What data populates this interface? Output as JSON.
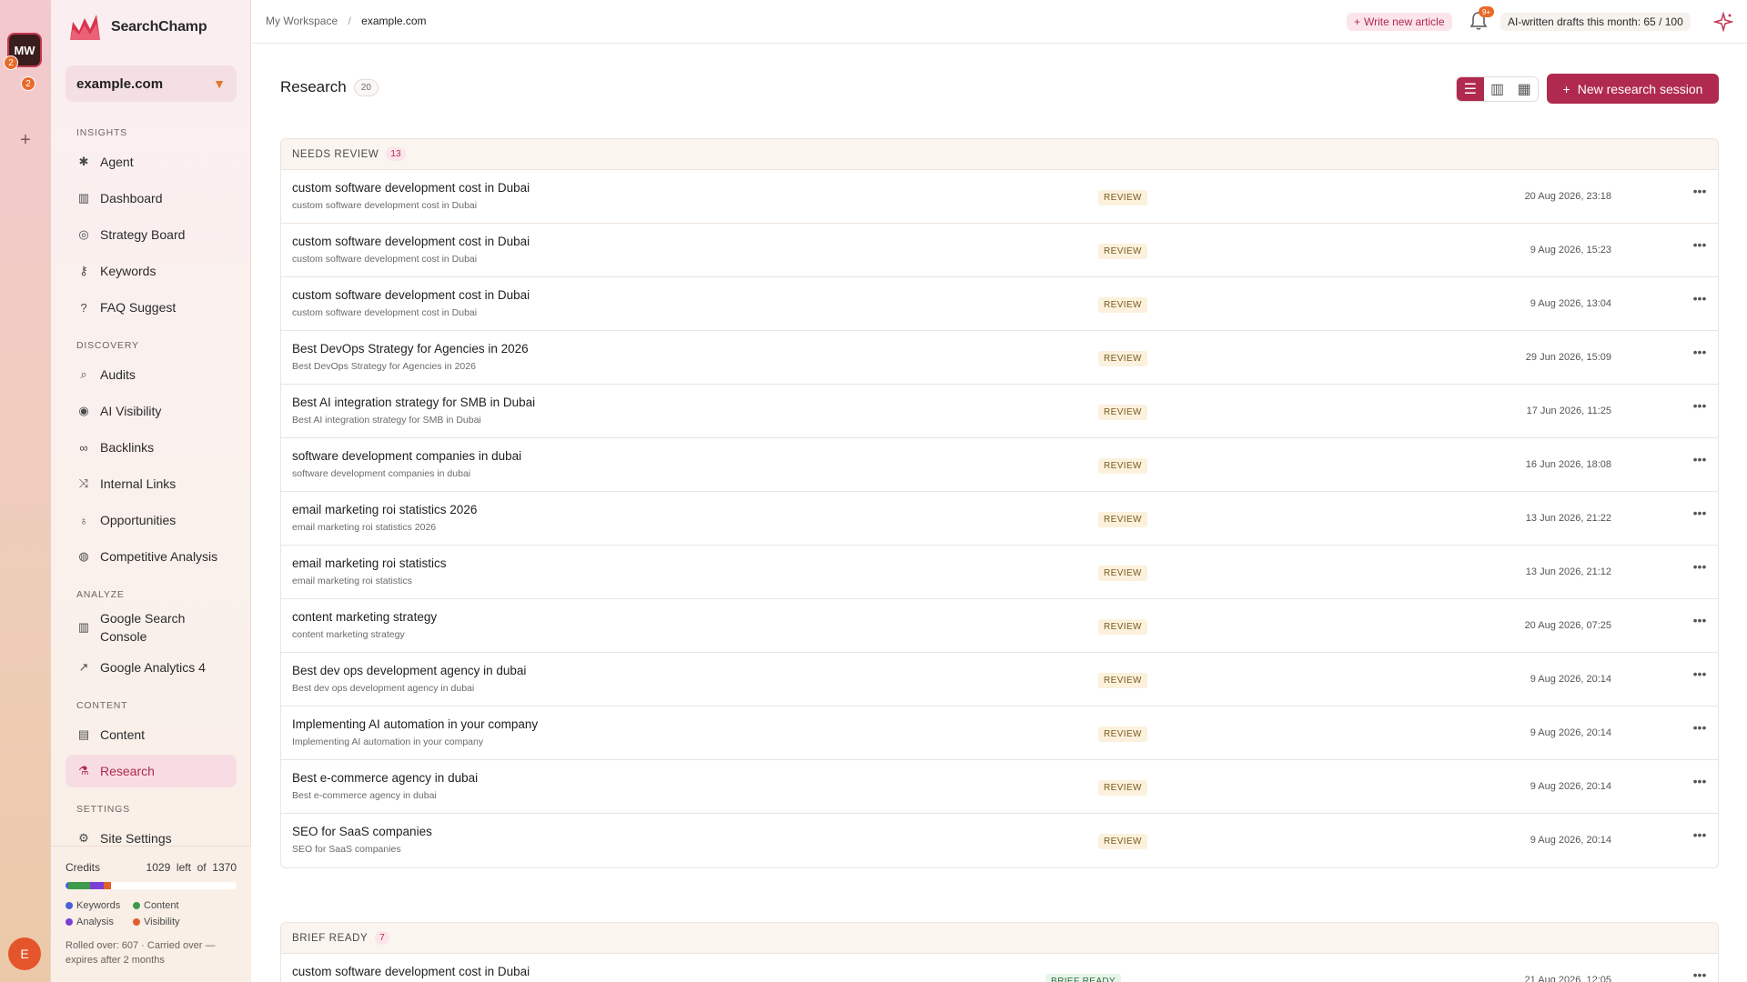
{
  "app": {
    "name": "SearchChamp"
  },
  "rail": {
    "workspace_initials": "MW",
    "badge_a": "2",
    "badge_b": "2",
    "add_label": "+",
    "user_initial": "E"
  },
  "site_selector": {
    "value": "example.com"
  },
  "sidebar": {
    "sections": [
      {
        "title": "INSIGHTS",
        "items": [
          {
            "label": "Agent",
            "icon": "sparkle-icon"
          },
          {
            "label": "Dashboard",
            "icon": "bar-chart-icon"
          },
          {
            "label": "Strategy Board",
            "icon": "target-icon"
          },
          {
            "label": "Keywords",
            "icon": "key-icon"
          },
          {
            "label": "FAQ Suggest",
            "icon": "question-icon"
          }
        ]
      },
      {
        "title": "DISCOVERY",
        "items": [
          {
            "label": "Audits",
            "icon": "search-icon"
          },
          {
            "label": "AI Visibility",
            "icon": "eye-icon"
          },
          {
            "label": "Backlinks",
            "icon": "link-icon"
          },
          {
            "label": "Internal Links",
            "icon": "share-icon"
          },
          {
            "label": "Opportunities",
            "icon": "lightbulb-icon"
          },
          {
            "label": "Competitive Analysis",
            "icon": "radar-icon"
          }
        ]
      },
      {
        "title": "ANALYZE",
        "items": [
          {
            "label": "Google Search Console",
            "icon": "bar-chart-icon"
          },
          {
            "label": "Google Analytics 4",
            "icon": "trend-icon"
          }
        ]
      },
      {
        "title": "CONTENT",
        "items": [
          {
            "label": "Content",
            "icon": "document-icon"
          },
          {
            "label": "Research",
            "icon": "flask-icon",
            "active": true
          }
        ]
      },
      {
        "title": "SETTINGS",
        "items": [
          {
            "label": "Site Settings",
            "icon": "gear-icon"
          }
        ]
      }
    ]
  },
  "credits": {
    "label": "Credits",
    "left": "1029",
    "left_word": "left",
    "of_word": "of",
    "total": "1370",
    "segments": [
      {
        "name": "Keywords",
        "color": "#4a5fd8",
        "fraction": 0.015
      },
      {
        "name": "Content",
        "color": "#3e9a4c",
        "fraction": 0.13
      },
      {
        "name": "Analysis",
        "color": "#7c3fd6",
        "fraction": 0.08
      },
      {
        "name": "Visibility",
        "color": "#e0602c",
        "fraction": 0.04
      }
    ],
    "note": "Rolled over: 607 · Carried over — expires after 2 months"
  },
  "topbar": {
    "breadcrumb": [
      "My Workspace",
      "example.com"
    ],
    "breadcrumb_sep": "/",
    "write_label": "Write new article",
    "notif_badge": "9+",
    "drafts_text": "AI-written drafts this month: 65 / 100"
  },
  "page": {
    "title": "Research",
    "count": "20",
    "new_button": "New research session"
  },
  "groups": [
    {
      "title": "NEEDS REVIEW",
      "count": "13",
      "status": "REVIEW",
      "rows": [
        {
          "title": "custom software development cost in Dubai",
          "sub": "custom software development cost in Dubai",
          "date": "20 Aug 2026, 23:18"
        },
        {
          "title": "custom software development cost in Dubai",
          "sub": "custom software development cost in Dubai",
          "date": "9 Aug 2026, 15:23"
        },
        {
          "title": "custom software development cost in Dubai",
          "sub": "custom software development cost in Dubai",
          "date": "9 Aug 2026, 13:04"
        },
        {
          "title": "Best DevOps Strategy for Agencies in 2026",
          "sub": "Best DevOps Strategy for Agencies in 2026",
          "date": "29 Jun 2026, 15:09"
        },
        {
          "title": "Best AI integration strategy for SMB in Dubai",
          "sub": "Best AI integration strategy for SMB in Dubai",
          "date": "17 Jun 2026, 11:25"
        },
        {
          "title": "software development companies in dubai",
          "sub": "software development companies in dubai",
          "date": "16 Jun 2026, 18:08"
        },
        {
          "title": "email marketing roi statistics 2026",
          "sub": "email marketing roi statistics 2026",
          "date": "13 Jun 2026, 21:22"
        },
        {
          "title": "email marketing roi statistics",
          "sub": "email marketing roi statistics",
          "date": "13 Jun 2026, 21:12"
        },
        {
          "title": "content marketing strategy",
          "sub": "content marketing strategy",
          "date": "20 Aug 2026, 07:25"
        },
        {
          "title": "Best dev ops development agency in dubai",
          "sub": "Best dev ops development agency in dubai",
          "date": "9 Aug 2026, 20:14"
        },
        {
          "title": "Implementing AI automation in your company",
          "sub": "Implementing AI automation in your company",
          "date": "9 Aug 2026, 20:14"
        },
        {
          "title": "Best e-commerce agency in dubai",
          "sub": "Best e-commerce agency in dubai",
          "date": "9 Aug 2026, 20:14"
        },
        {
          "title": "SEO for SaaS companies",
          "sub": "SEO for SaaS companies",
          "date": "9 Aug 2026, 20:14"
        }
      ]
    },
    {
      "title": "BRIEF READY",
      "count": "7",
      "status": "BRIEF READY",
      "rows": [
        {
          "title": "custom software development cost in Dubai",
          "sub": "",
          "date": "21 Aug 2026, 12:05"
        }
      ]
    }
  ]
}
